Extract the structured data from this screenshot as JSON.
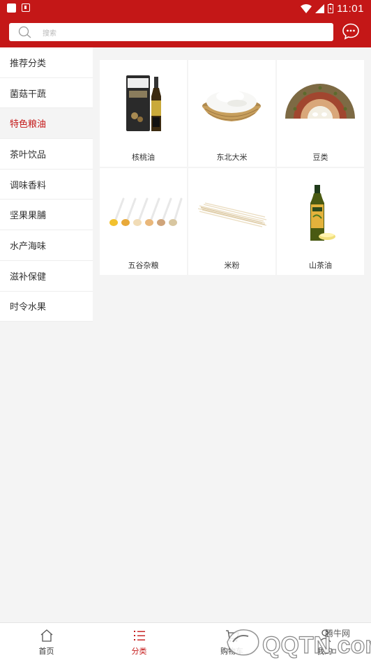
{
  "status_bar": {
    "time": "11:01"
  },
  "search": {
    "placeholder": "搜索"
  },
  "sidebar": {
    "items": [
      {
        "label": "推荐分类"
      },
      {
        "label": "菌菇干蔬"
      },
      {
        "label": "特色粮油",
        "active": true
      },
      {
        "label": "茶叶饮品"
      },
      {
        "label": "调味香料"
      },
      {
        "label": "坚果果脯"
      },
      {
        "label": "水产海味"
      },
      {
        "label": "滋补保健"
      },
      {
        "label": "时令水果"
      }
    ]
  },
  "products": [
    {
      "label": "核桃油",
      "icon": "walnut-oil-image"
    },
    {
      "label": "东北大米",
      "icon": "rice-basket-image"
    },
    {
      "label": "豆类",
      "icon": "beans-image"
    },
    {
      "label": "五谷杂粮",
      "icon": "grain-spoons-image"
    },
    {
      "label": "米粉",
      "icon": "rice-noodles-image"
    },
    {
      "label": "山茶油",
      "icon": "camellia-oil-image"
    }
  ],
  "tabbar": {
    "tabs": [
      {
        "label": "首页",
        "icon": "home-icon"
      },
      {
        "label": "分类",
        "icon": "list-icon",
        "active": true
      },
      {
        "label": "购物车",
        "icon": "cart-icon"
      },
      {
        "label": "我的",
        "icon": "user-icon"
      }
    ]
  },
  "watermark": {
    "text": "腾牛网",
    "domain": "QQTN.com"
  },
  "colors": {
    "brand": "#c41717",
    "background": "#f4f4f4"
  }
}
